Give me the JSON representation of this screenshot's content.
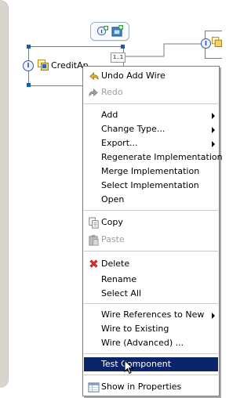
{
  "canvas": {
    "component_label": "CreditAp",
    "ref_badge": "1..1",
    "interface_glyph": "I"
  },
  "hover_toolbar": {
    "add_interface_icon": "interface-plus-icon",
    "add_reference_icon": "reference-plus-icon"
  },
  "menu": {
    "items": [
      {
        "label": "Undo Add Wire",
        "icon": "undo-icon",
        "enabled": true
      },
      {
        "label": "Redo",
        "icon": "redo-icon",
        "enabled": false
      },
      {
        "label": "Add",
        "submenu": true,
        "enabled": true
      },
      {
        "label": "Change Type...",
        "submenu": true,
        "enabled": true
      },
      {
        "label": "Export...",
        "submenu": true,
        "enabled": true
      },
      {
        "label": "Regenerate Implementation",
        "enabled": true
      },
      {
        "label": "Merge Implementation",
        "enabled": true
      },
      {
        "label": "Select Implementation",
        "enabled": true
      },
      {
        "label": "Open",
        "enabled": true
      },
      {
        "label": "Copy",
        "icon": "copy-icon",
        "enabled": true
      },
      {
        "label": "Paste",
        "icon": "paste-icon",
        "enabled": false
      },
      {
        "label": "Delete",
        "icon": "delete-icon",
        "enabled": true
      },
      {
        "label": "Rename",
        "enabled": true
      },
      {
        "label": "Select All",
        "enabled": true
      },
      {
        "label": "Wire References to New",
        "submenu": true,
        "enabled": true
      },
      {
        "label": "Wire to Existing",
        "enabled": true
      },
      {
        "label": "Wire (Advanced) ...",
        "enabled": true
      },
      {
        "label": "Test Component",
        "enabled": true,
        "selected": true
      },
      {
        "label": "Show in Properties",
        "icon": "properties-icon",
        "enabled": true
      }
    ]
  },
  "colors": {
    "selection_bg": "#0a246a",
    "selection_fg": "#ffffff",
    "disabled_fg": "#a0a0a0",
    "separator": "#c9c9c9"
  }
}
